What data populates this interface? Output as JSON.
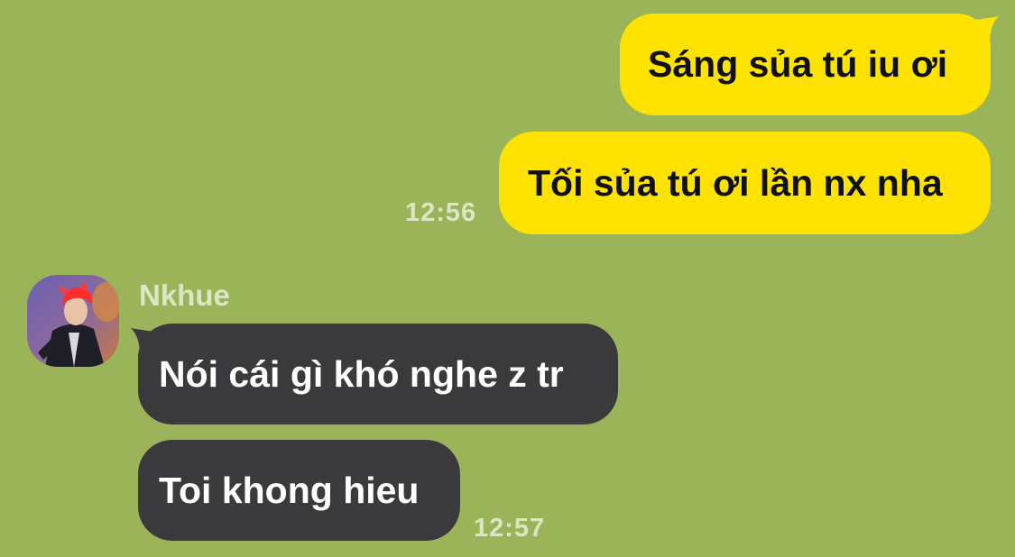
{
  "chat": {
    "outgoing": {
      "messages": [
        {
          "text": "Sáng sủa tú iu ơi"
        },
        {
          "text": "Tối sủa tú ơi lần nx nha"
        }
      ],
      "time": "12:56"
    },
    "incoming": {
      "sender": "Nkhue",
      "avatar_icon": "profile-photo-red-hair",
      "messages": [
        {
          "text": "Nói cái gì khó nghe z tr"
        },
        {
          "text": "Toi khong hieu"
        }
      ],
      "time": "12:57"
    }
  },
  "colors": {
    "background": "#9bb459",
    "outgoing_bubble": "#ffe300",
    "incoming_bubble": "#3a3a3c",
    "meta_text": "#dde6c2"
  }
}
